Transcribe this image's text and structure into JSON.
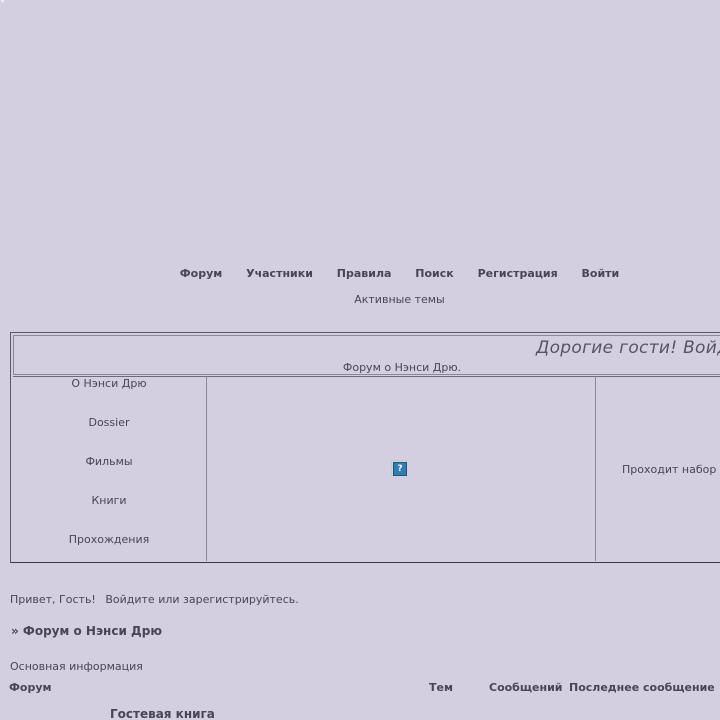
{
  "corner_mark": "*",
  "nav": {
    "forum": "Форум",
    "members": "Участники",
    "rules": "Правила",
    "search": "Поиск",
    "register": "Регистрация",
    "login": "Войти",
    "active_topics": "Активные темы"
  },
  "banner": {
    "welcome": "Дорогие гости! Войди",
    "subtitle": "Форум о Нэнси Дрю.",
    "menu": [
      "О Нэнси Дрю",
      "Dossier",
      "Фильмы",
      "Книги",
      "Прохождения"
    ],
    "image_icon": "broken-image-icon",
    "right_text": "Проходит набор мо"
  },
  "greeting": {
    "hello": "Привет, Гость!",
    "links": "Войдите или зарегистрируйтесь."
  },
  "breadcrumb": "» Форум о Нэнси Дрю",
  "section": {
    "title": "Основная информация",
    "columns": {
      "forum": "Форум",
      "topics": "Тем",
      "posts": "Сообщений",
      "last_post": "Последнее сообщение"
    },
    "rows": [
      {
        "name": "Гостевая книга"
      }
    ]
  }
}
